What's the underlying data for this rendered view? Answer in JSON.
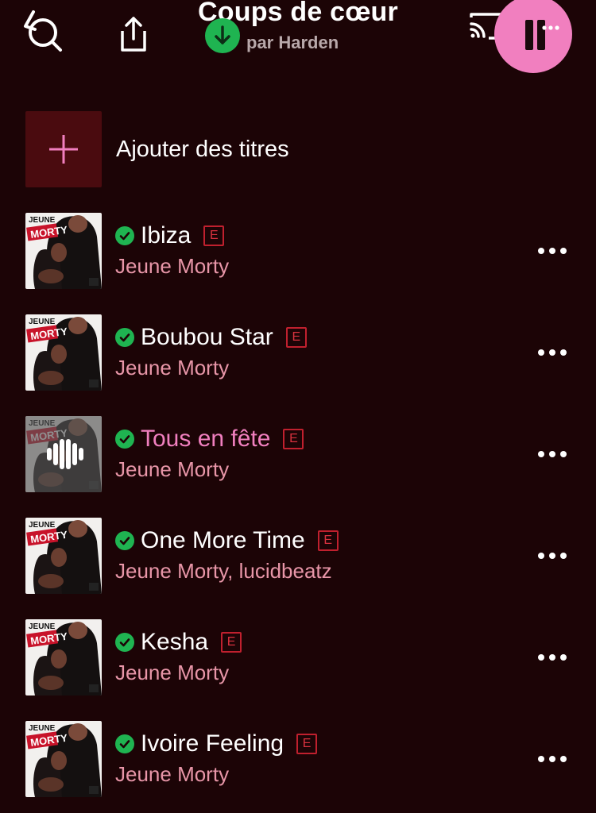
{
  "header": {
    "title": "Coups de cœur",
    "subtitle": "par Harden",
    "icons": {
      "back": "back-search-icon",
      "share": "share-icon",
      "download": "download-icon",
      "cast": "cast-icon",
      "more": "more-icon",
      "pause": "pause-icon"
    }
  },
  "add": {
    "label": "Ajouter des titres",
    "icon": "plus-icon"
  },
  "explicit_label": "E",
  "colors": {
    "background": "#1c0406",
    "accent": "#f17fbf",
    "downloaded": "#1fb451",
    "explicit": "#c0202e",
    "artist": "#e896a8"
  },
  "tracks": [
    {
      "title": "Ibiza",
      "artist": "Jeune Morty",
      "explicit": true,
      "downloaded": true,
      "playing": false
    },
    {
      "title": "Boubou Star",
      "artist": "Jeune Morty",
      "explicit": true,
      "downloaded": true,
      "playing": false
    },
    {
      "title": "Tous en fête",
      "artist": "Jeune Morty",
      "explicit": true,
      "downloaded": true,
      "playing": true
    },
    {
      "title": "One More Time",
      "artist": "Jeune Morty, lucidbeatz",
      "explicit": true,
      "downloaded": true,
      "playing": false
    },
    {
      "title": "Kesha",
      "artist": "Jeune Morty",
      "explicit": true,
      "downloaded": true,
      "playing": false
    },
    {
      "title": "Ivoire Feeling",
      "artist": "Jeune Morty",
      "explicit": true,
      "downloaded": true,
      "playing": false
    }
  ]
}
